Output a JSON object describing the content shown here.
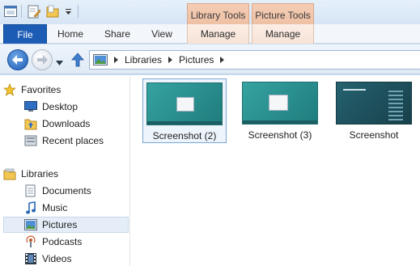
{
  "quick_access": {
    "icons": [
      "window-icon",
      "properties-icon",
      "new-folder-icon",
      "customize-dropdown-icon"
    ]
  },
  "contextual_tabs": {
    "library_tools": "Library Tools",
    "picture_tools": "Picture Tools"
  },
  "ribbon_tabs": {
    "file": "File",
    "home": "Home",
    "share": "Share",
    "view": "View",
    "manage_library": "Manage",
    "manage_picture": "Manage"
  },
  "address_bar": {
    "crumbs": [
      "Libraries",
      "Pictures"
    ]
  },
  "nav_pane": {
    "favorites_header": "Favorites",
    "favorites": [
      {
        "label": "Desktop",
        "icon": "desktop-icon"
      },
      {
        "label": "Downloads",
        "icon": "downloads-icon"
      },
      {
        "label": "Recent places",
        "icon": "recent-places-icon"
      }
    ],
    "libraries_header": "Libraries",
    "libraries": [
      {
        "label": "Documents",
        "icon": "documents-icon"
      },
      {
        "label": "Music",
        "icon": "music-icon"
      },
      {
        "label": "Pictures",
        "icon": "pictures-icon",
        "selected": true
      },
      {
        "label": "Podcasts",
        "icon": "podcasts-icon"
      },
      {
        "label": "Videos",
        "icon": "videos-icon"
      }
    ]
  },
  "files": [
    {
      "name": "Screenshot (2)",
      "selected": true
    },
    {
      "name": "Screenshot (3)",
      "selected": false
    },
    {
      "name": "Screenshot",
      "selected": false
    }
  ],
  "colors": {
    "file_tab": "#1c5cb4",
    "contextual_tab": "#f0c4a8",
    "thumbnail_teal": "#2a8f8f",
    "thumbnail_dark": "#1f4e5a"
  }
}
